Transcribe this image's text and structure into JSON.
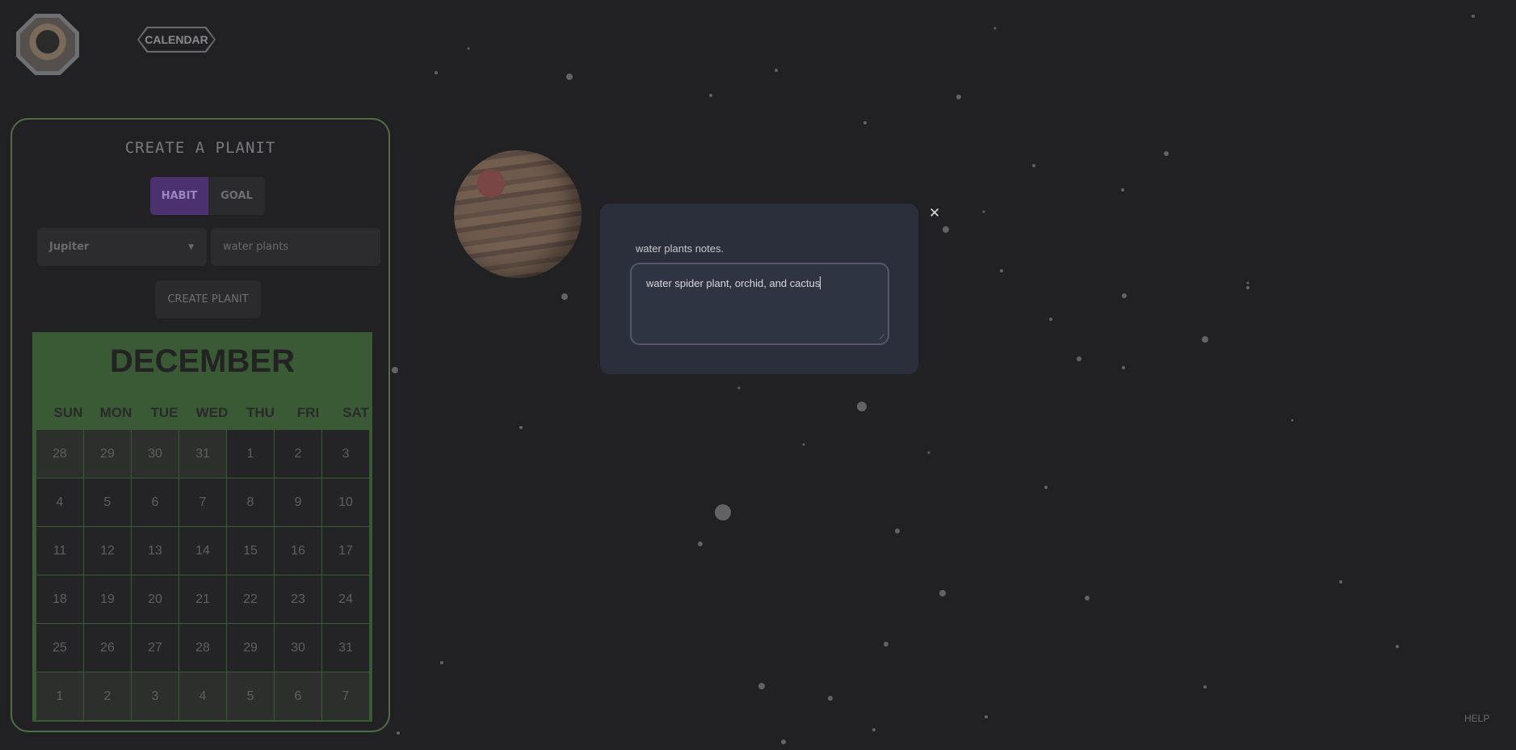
{
  "header": {
    "calendar_label": "CALENDAR"
  },
  "panel": {
    "title": "CREATE A PLANIT",
    "toggle": {
      "habit_label": "HABIT",
      "goal_label": "GOAL",
      "selected": "HABIT"
    },
    "planet_select": {
      "value": "Jupiter"
    },
    "name_input": {
      "placeholder": "water plants"
    },
    "create_button_label": "CREATE PLANIT"
  },
  "calendar": {
    "month": "DECEMBER",
    "weekdays": [
      "SUN",
      "MON",
      "TUE",
      "WED",
      "THU",
      "FRI",
      "SAT"
    ],
    "days": [
      "28",
      "29",
      "30",
      "31",
      "1",
      "2",
      "3",
      "4",
      "5",
      "6",
      "7",
      "8",
      "9",
      "10",
      "11",
      "12",
      "13",
      "14",
      "15",
      "16",
      "17",
      "18",
      "19",
      "20",
      "21",
      "22",
      "23",
      "24",
      "25",
      "26",
      "27",
      "28",
      "29",
      "30",
      "31",
      "1",
      "2",
      "3",
      "4",
      "5",
      "6",
      "7"
    ],
    "outside_month": [
      0,
      1,
      2,
      3,
      35,
      36,
      37,
      38,
      39,
      40,
      41
    ]
  },
  "notes_modal": {
    "label": "water plants notes.",
    "text": "water spider plant, orchid, and cactus",
    "close_icon": "close-icon"
  },
  "footer": {
    "help_label": "HELP"
  },
  "colors": {
    "background": "#212124",
    "panel_border": "#4e6e45",
    "calendar_green": "#3a5a35",
    "habit_purple": "#4b3170",
    "modal_bg": "#2b2f3b"
  }
}
